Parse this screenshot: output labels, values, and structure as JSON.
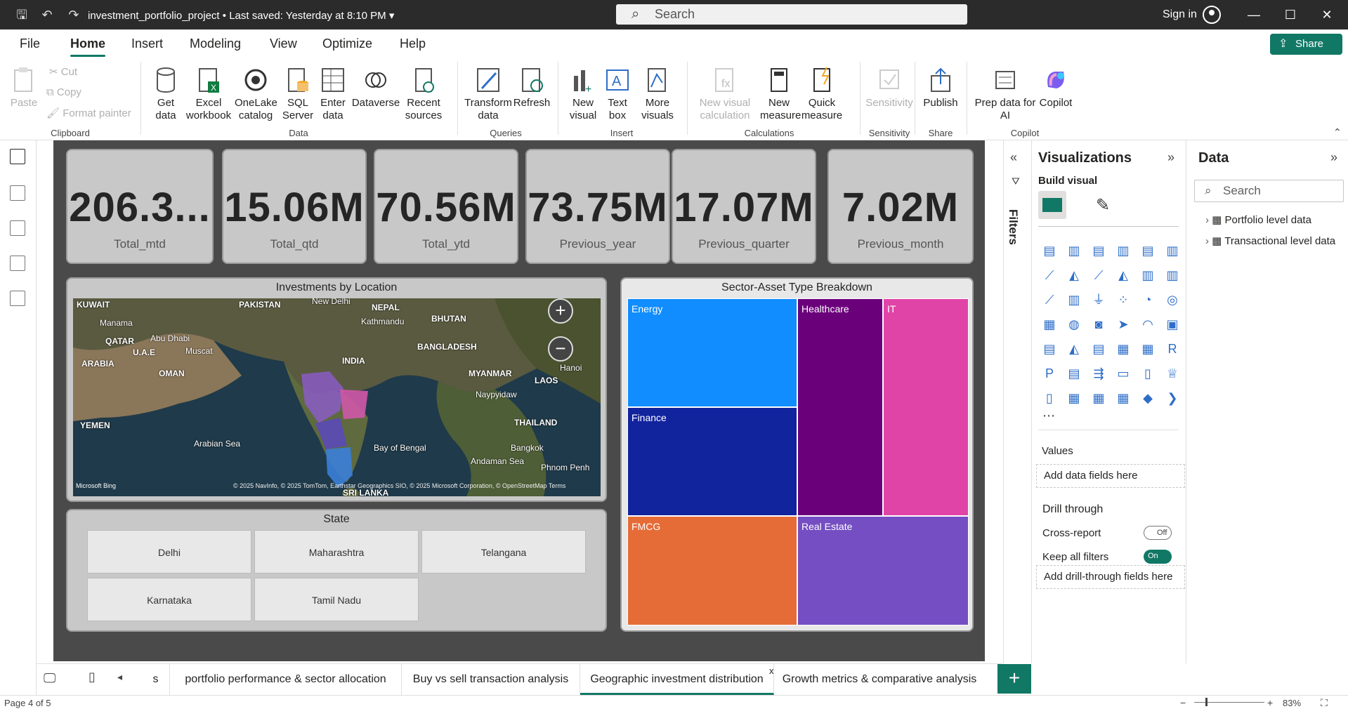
{
  "titlebar": {
    "title": "investment_portfolio_project",
    "saved": "• Last saved: Yesterday at 8:10 PM",
    "search_placeholder": "Search",
    "signin": "Sign in"
  },
  "menu": [
    "File",
    "Home",
    "Insert",
    "Modeling",
    "View",
    "Optimize",
    "Help"
  ],
  "share": "Share",
  "ribbon": {
    "clipboard": {
      "paste": "Paste",
      "cut": "Cut",
      "copy": "Copy",
      "format_painter": "Format painter",
      "group": "Clipboard"
    },
    "data": {
      "get_data": "Get data",
      "excel": "Excel workbook",
      "onelake": "OneLake catalog",
      "sql": "SQL Server",
      "enter": "Enter data",
      "dataverse": "Dataverse",
      "recent": "Recent sources",
      "group": "Data"
    },
    "queries": {
      "transform": "Transform data",
      "refresh": "Refresh",
      "group": "Queries"
    },
    "insert": {
      "new_visual": "New visual",
      "text_box": "Text box",
      "more_visuals": "More visuals",
      "group": "Insert"
    },
    "calculations": {
      "new_visual_calc": "New visual calculation",
      "new_measure": "New measure",
      "quick_measure": "Quick measure",
      "group": "Calculations"
    },
    "sensitivity": {
      "label": "Sensitivity",
      "group": "Sensitivity"
    },
    "share": {
      "publish": "Publish",
      "group": "Share"
    },
    "copilot": {
      "prep": "Prep data for AI",
      "copilot": "Copilot",
      "group": "Copilot"
    }
  },
  "kpis": [
    {
      "value": "206.3...",
      "label": "Total_mtd"
    },
    {
      "value": "15.06M",
      "label": "Total_qtd"
    },
    {
      "value": "70.56M",
      "label": "Total_ytd"
    },
    {
      "value": "73.75M",
      "label": "Previous_year"
    },
    {
      "value": "17.07M",
      "label": "Previous_quarter"
    },
    {
      "value": "7.02M",
      "label": "Previous_month"
    }
  ],
  "map": {
    "title": "Investments by Location",
    "labels": [
      "KUWAIT",
      "PAKISTAN",
      "New Delhi",
      "NEPAL",
      "BHUTAN",
      "Manama",
      "QATAR",
      "Abu Dhabi",
      "U.A.E",
      "Muscat",
      "Kathmandu",
      "BANGLADESH",
      "INDIA",
      "ARABIA",
      "OMAN",
      "MYANMAR",
      "LAOS",
      "Hanoi",
      "Naypyidaw",
      "YEMEN",
      "THAILAND",
      "Arabian Sea",
      "Bay of Bengal",
      "Bangkok",
      "Andaman Sea",
      "Phnom Penh",
      "SRI LANKA"
    ],
    "attribution": "© 2025 NavInfo, © 2025 TomTom, Earthstar Geographics SIO, © 2025 Microsoft Corporation, © OpenStreetMap  Terms",
    "bing": "Microsoft Bing"
  },
  "slicer": {
    "title": "State",
    "items": [
      "Delhi",
      "Maharashtra",
      "Telangana",
      "Karnataka",
      "Tamil Nadu"
    ]
  },
  "treemap": {
    "title": "Sector-Asset Type Breakdown",
    "items": [
      {
        "name": "Energy",
        "color": "#118DFF"
      },
      {
        "name": "Finance",
        "color": "#12239E"
      },
      {
        "name": "FMCG",
        "color": "#E66C37"
      },
      {
        "name": "Healthcare",
        "color": "#6B007B"
      },
      {
        "name": "IT",
        "color": "#E044A7"
      },
      {
        "name": "Real Estate",
        "color": "#744EC2"
      }
    ]
  },
  "filters_label": "Filters",
  "visualizations": {
    "title": "Visualizations",
    "build": "Build visual",
    "values": "Values",
    "values_well": "Add data fields here",
    "drill": "Drill through",
    "cross_report": "Cross-report",
    "cross_state": "Off",
    "keep_filters": "Keep all filters",
    "keep_state": "On",
    "drill_well": "Add drill-through fields here"
  },
  "data_pane": {
    "title": "Data",
    "search_placeholder": "Search",
    "tables": [
      "Portfolio level data",
      "Transactional level data"
    ]
  },
  "tabs": [
    "s",
    "portfolio performance & sector allocation",
    "Buy vs sell transaction analysis",
    "Geographic investment distribution",
    "Growth metrics & comparative analysis"
  ],
  "status": {
    "page": "Page 4 of 5",
    "zoom": "83%"
  }
}
